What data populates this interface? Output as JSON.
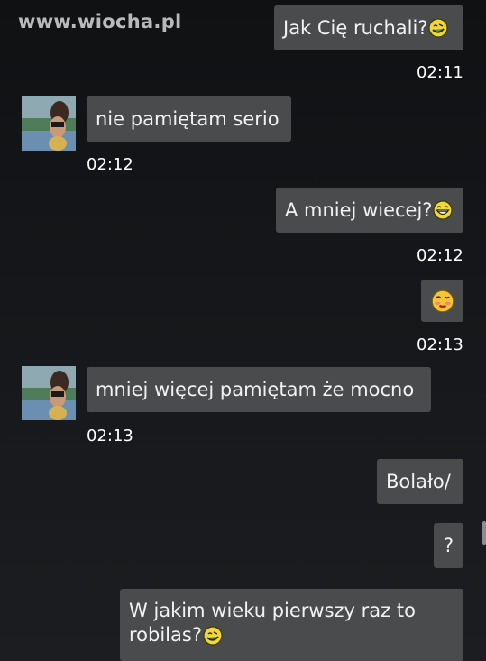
{
  "watermark": "www.wiocha.pl",
  "messages": [
    {
      "text": "Jak Cię ruchali?",
      "emoji": "wink-smile-icon",
      "time": "02:11"
    },
    {
      "text": "nie pamiętam serio",
      "time": "02:12"
    },
    {
      "text": "A mniej wiecej?",
      "emoji": "grin-icon",
      "time": "02:12"
    },
    {
      "text": "",
      "emoji": "kiss-blush-icon",
      "time": "02:13"
    },
    {
      "text": "mniej więcej pamiętam że mocno",
      "time": "02:13"
    },
    {
      "text": "Bolało/"
    },
    {
      "text": "?"
    },
    {
      "text_line1": "W jakim wieku pierwszy raz to",
      "text_line2": "robilas?",
      "emoji": "wink-smile-icon"
    }
  ],
  "colors": {
    "bubble": "#4a4b4d",
    "background": "#15171a",
    "text": "#f2f2f2",
    "emoji_face": "#f7d23e"
  }
}
